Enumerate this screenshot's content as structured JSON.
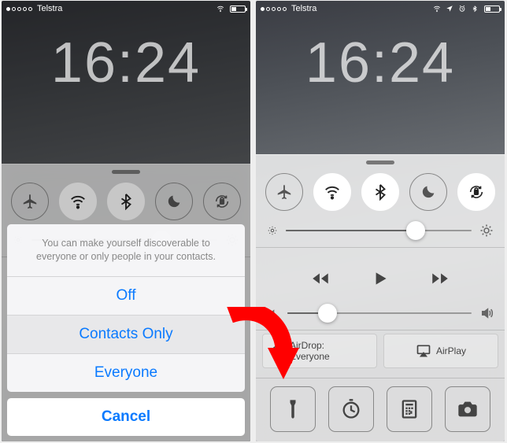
{
  "status": {
    "carrier": "Telstra"
  },
  "clock": {
    "time": "16:24"
  },
  "toggles": {
    "airplane": false,
    "wifi": true,
    "bluetooth": true,
    "dnd": false,
    "lock": true
  },
  "brightness": {
    "value_pct": 70
  },
  "volume": {
    "value_pct": 22
  },
  "airdrop": {
    "label": "AirDrop:",
    "mode": "Everyone"
  },
  "airplay": {
    "label": "AirPlay"
  },
  "sheet": {
    "message": "You can make yourself discoverable to everyone or only people in your contacts.",
    "off": "Off",
    "contacts": "Contacts Only",
    "everyone": "Everyone",
    "cancel": "Cancel"
  }
}
